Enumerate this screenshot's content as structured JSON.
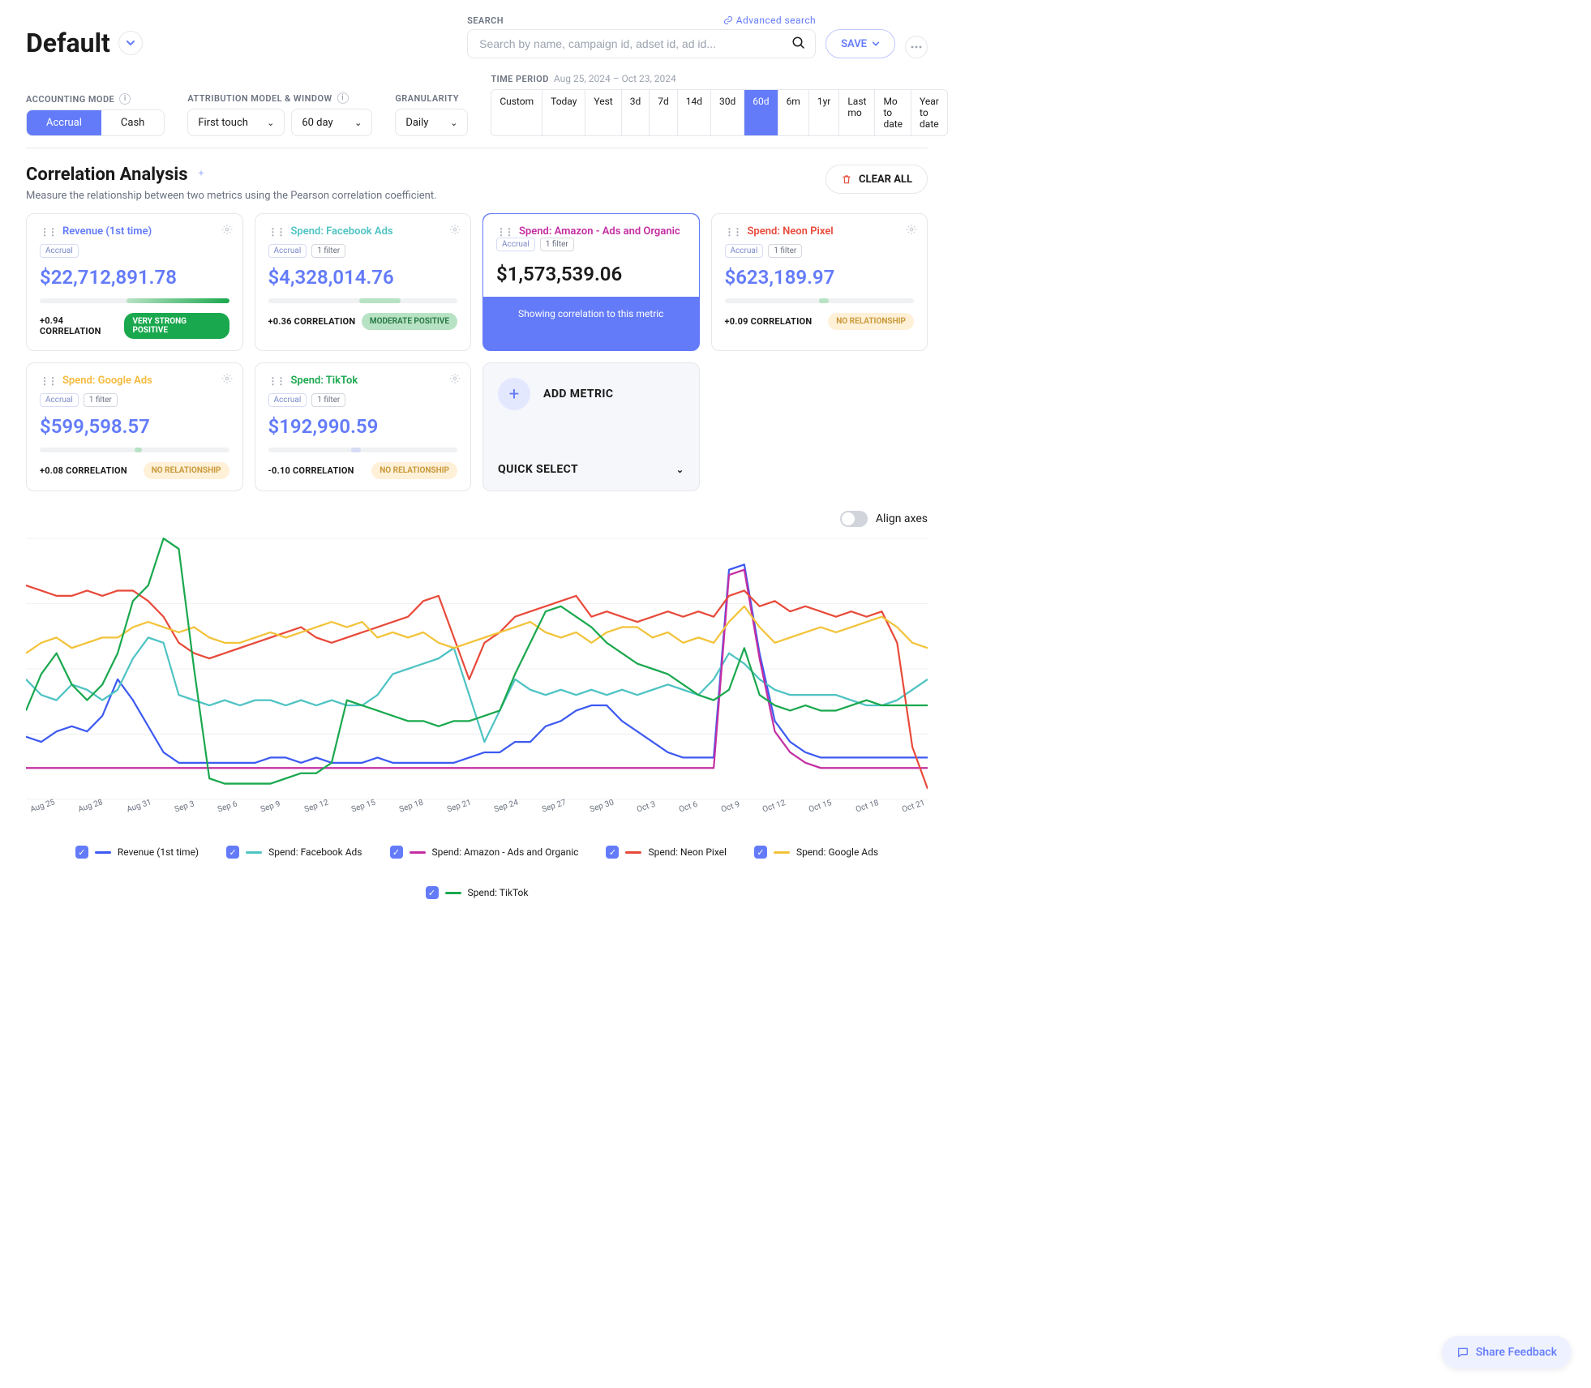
{
  "header": {
    "title": "Default",
    "search_label": "SEARCH",
    "advanced_link": "Advanced search",
    "search_placeholder": "Search by name, campaign id, adset id, ad id...",
    "save_label": "SAVE"
  },
  "controls": {
    "accounting_label": "ACCOUNTING MODE",
    "accounting_options": [
      "Accrual",
      "Cash"
    ],
    "accounting_active": "Accrual",
    "attribution_label": "ATTRIBUTION MODEL & WINDOW",
    "attribution_model": "First touch",
    "attribution_window": "60 day",
    "granularity_label": "GRANULARITY",
    "granularity_value": "Daily",
    "time_label": "TIME PERIOD",
    "time_range": "Aug 25, 2024 – Oct 23, 2024",
    "time_pills": [
      "Custom",
      "Today",
      "Yest",
      "3d",
      "7d",
      "14d",
      "30d",
      "60d",
      "6m",
      "1yr",
      "Last mo",
      "Mo to date",
      "Year to date"
    ],
    "time_active": "60d"
  },
  "section": {
    "title": "Correlation Analysis",
    "subtitle": "Measure the relationship between two metrics using the Pearson correlation coefficient.",
    "clear_label": "CLEAR ALL"
  },
  "cards": [
    {
      "id": "revenue",
      "name": "Revenue (1st time)",
      "color": "#637bf9",
      "tags": [
        "Accrual"
      ],
      "value": "$22,712,891.78",
      "correlation": "+0.94 CORRELATION",
      "pill": "VERY STRONG POSITIVE",
      "pill_class": "strong",
      "bar_from": 46,
      "bar_to": 100,
      "bar_color": "linear-gradient(90deg,#b7e2c3,#1aa84e)"
    },
    {
      "id": "facebook",
      "name": "Spend: Facebook Ads",
      "color": "#4fc3c3",
      "tags": [
        "Accrual",
        "1 filter"
      ],
      "value": "$4,328,014.76",
      "correlation": "+0.36 CORRELATION",
      "pill": "MODERATE POSITIVE",
      "pill_class": "mod",
      "bar_from": 48,
      "bar_to": 70,
      "bar_color": "#b7e2c3"
    },
    {
      "id": "amazon",
      "name": "Spend: Amazon - Ads and Organic",
      "color": "#c42ea3",
      "tags": [
        "Accrual",
        "1 filter"
      ],
      "value": "$1,573,539.06",
      "active": true,
      "active_text": "Showing correlation to this metric"
    },
    {
      "id": "neon",
      "name": "Spend: Neon Pixel",
      "color": "#e84a3a",
      "tags": [
        "Accrual",
        "1 filter"
      ],
      "value": "$623,189.97",
      "correlation": "+0.09 CORRELATION",
      "pill": "NO RELATIONSHIP",
      "pill_class": "none",
      "bar_from": 50,
      "bar_to": 55,
      "bar_color": "#b7e2c3"
    },
    {
      "id": "google",
      "name": "Spend: Google Ads",
      "color": "#f5b93a",
      "tags": [
        "Accrual",
        "1 filter"
      ],
      "value": "$599,598.57",
      "correlation": "+0.08 CORRELATION",
      "pill": "NO RELATIONSHIP",
      "pill_class": "none",
      "bar_from": 50,
      "bar_to": 54,
      "bar_color": "#b7e2c3"
    },
    {
      "id": "tiktok",
      "name": "Spend: TikTok",
      "color": "#1aa84e",
      "tags": [
        "Accrual",
        "1 filter"
      ],
      "value": "$192,990.59",
      "correlation": "-0.10 CORRELATION",
      "pill": "NO RELATIONSHIP",
      "pill_class": "none",
      "bar_from": 44,
      "bar_to": 49,
      "bar_color": "#d7dcf5"
    }
  ],
  "add_card": {
    "add_label": "ADD METRIC",
    "quick_label": "QUICK SELECT"
  },
  "chart_toggle": {
    "label": "Align axes"
  },
  "chart_data": {
    "type": "line",
    "title": "",
    "xlabel": "",
    "ylabel": "",
    "ylim": [
      0,
      100
    ],
    "x_labels": [
      "Aug 25",
      "Aug 28",
      "Aug 31",
      "Sep 3",
      "Sep 6",
      "Sep 9",
      "Sep 12",
      "Sep 15",
      "Sep 18",
      "Sep 21",
      "Sep 24",
      "Sep 27",
      "Sep 30",
      "Oct 3",
      "Oct 6",
      "Oct 9",
      "Oct 12",
      "Oct 15",
      "Oct 18",
      "Oct 21"
    ],
    "series": [
      {
        "name": "Revenue (1st time)",
        "color": "#3d5af1",
        "values": [
          24,
          22,
          26,
          28,
          26,
          32,
          46,
          38,
          28,
          18,
          14,
          14,
          14,
          14,
          14,
          14,
          16,
          16,
          14,
          16,
          14,
          14,
          14,
          16,
          14,
          14,
          14,
          14,
          14,
          16,
          18,
          18,
          22,
          22,
          28,
          30,
          34,
          36,
          36,
          30,
          26,
          22,
          18,
          16,
          16,
          16,
          88,
          90,
          56,
          30,
          22,
          18,
          16,
          16,
          16,
          16,
          16,
          16,
          16,
          16
        ]
      },
      {
        "name": "Spend: Facebook Ads",
        "color": "#4fc3c3",
        "values": [
          46,
          40,
          38,
          44,
          42,
          38,
          42,
          54,
          62,
          60,
          40,
          38,
          36,
          38,
          36,
          38,
          38,
          36,
          38,
          36,
          38,
          36,
          36,
          40,
          48,
          50,
          52,
          54,
          58,
          40,
          22,
          34,
          46,
          42,
          40,
          42,
          40,
          42,
          40,
          42,
          40,
          42,
          44,
          42,
          40,
          46,
          56,
          52,
          46,
          42,
          40,
          40,
          40,
          40,
          38,
          36,
          36,
          38,
          42,
          46
        ]
      },
      {
        "name": "Spend: Amazon - Ads and Organic",
        "color": "#c42ea3",
        "values": [
          12,
          12,
          12,
          12,
          12,
          12,
          12,
          12,
          12,
          12,
          12,
          12,
          12,
          12,
          12,
          12,
          12,
          12,
          12,
          12,
          12,
          12,
          12,
          12,
          12,
          12,
          12,
          12,
          12,
          12,
          12,
          12,
          12,
          12,
          12,
          12,
          12,
          12,
          12,
          12,
          12,
          12,
          12,
          12,
          12,
          12,
          86,
          88,
          54,
          26,
          18,
          14,
          12,
          12,
          12,
          12,
          12,
          12,
          12,
          12
        ]
      },
      {
        "name": "Spend: Neon Pixel",
        "color": "#e84a3a",
        "values": [
          82,
          80,
          78,
          78,
          80,
          78,
          80,
          80,
          76,
          70,
          60,
          56,
          54,
          56,
          58,
          60,
          62,
          64,
          66,
          62,
          60,
          62,
          64,
          66,
          68,
          70,
          76,
          78,
          62,
          46,
          60,
          64,
          70,
          72,
          74,
          76,
          78,
          70,
          72,
          70,
          68,
          70,
          72,
          70,
          72,
          70,
          78,
          80,
          74,
          76,
          72,
          74,
          72,
          70,
          72,
          70,
          72,
          60,
          20,
          4
        ]
      },
      {
        "name": "Spend: Google Ads",
        "color": "#f2c33a",
        "values": [
          56,
          60,
          62,
          58,
          60,
          62,
          62,
          66,
          68,
          66,
          64,
          66,
          62,
          60,
          60,
          62,
          64,
          62,
          64,
          66,
          68,
          66,
          68,
          62,
          64,
          62,
          64,
          60,
          58,
          60,
          62,
          64,
          66,
          68,
          64,
          62,
          64,
          60,
          64,
          66,
          66,
          62,
          64,
          60,
          62,
          60,
          68,
          74,
          66,
          60,
          62,
          64,
          66,
          64,
          66,
          68,
          70,
          66,
          60,
          58
        ]
      },
      {
        "name": "Spend: TikTok",
        "color": "#1aa84e",
        "values": [
          34,
          48,
          56,
          44,
          38,
          44,
          56,
          76,
          82,
          100,
          96,
          50,
          8,
          6,
          6,
          6,
          6,
          8,
          10,
          10,
          14,
          38,
          36,
          34,
          32,
          30,
          30,
          28,
          30,
          30,
          32,
          34,
          48,
          60,
          72,
          74,
          70,
          66,
          60,
          56,
          52,
          50,
          48,
          44,
          40,
          38,
          42,
          58,
          40,
          36,
          34,
          36,
          34,
          34,
          36,
          38,
          36,
          36,
          36,
          36
        ]
      }
    ]
  },
  "legend": [
    {
      "label": "Revenue (1st time)",
      "color": "#3d5af1"
    },
    {
      "label": "Spend: Facebook Ads",
      "color": "#4fc3c3"
    },
    {
      "label": "Spend: Amazon - Ads and Organic",
      "color": "#c42ea3"
    },
    {
      "label": "Spend: Neon Pixel",
      "color": "#e84a3a"
    },
    {
      "label": "Spend: Google Ads",
      "color": "#f2c33a"
    },
    {
      "label": "Spend: TikTok",
      "color": "#1aa84e"
    }
  ],
  "feedback_label": "Share Feedback"
}
